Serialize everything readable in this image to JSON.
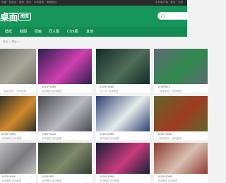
{
  "topbar": {
    "left_text": "收藏  · 壁纸站  · 搜索 · 图片 · 手机壁纸  · 桌面壁纸",
    "right_text": "手机客户端  · 登录  · 注册"
  },
  "logo": {
    "text": "桌面",
    "badge": "图库"
  },
  "search": {
    "placeholder": ""
  },
  "nav": {
    "items": [
      "壁纸",
      "截图",
      "原画",
      "同人图",
      "COS图",
      "其他"
    ]
  },
  "breadcrumb": "首页 > 壁纸 >",
  "cards": [
    {
      "thumb_color": "#6f6f6a",
      "accent": "#a9a79a",
      "resolution": "",
      "meta": "「某某游戏」 游戏截图"
    },
    {
      "thumb_color": "#2a1f4f",
      "accent": "#cf3fb0",
      "resolution": "1920*1080",
      "meta": "游戏截图 游戏截图"
    },
    {
      "thumb_color": "#132a2a",
      "accent": "#4f6e57",
      "resolution": "1920*1080",
      "meta": "Sunset 游戏截图"
    },
    {
      "thumb_color": "#5d6a75",
      "accent": "#2f8a4c",
      "resolution": "1440*810",
      "meta": "「某某游戏」游戏截图"
    },
    {
      "thumb_color": "#2c2f24",
      "accent": "#d28a2c",
      "resolution": "1920*1080",
      "meta": "游戏截图 游戏截图"
    },
    {
      "thumb_color": "#494a4f",
      "accent": "#b9b9c1",
      "resolution": "2560*1440",
      "meta": "游戏截图 游戏截图"
    },
    {
      "thumb_color": "#2c3f73",
      "accent": "#e4ece9",
      "resolution": "1920*1080",
      "meta": "游戏截图 游戏截图"
    },
    {
      "thumb_color": "#61642f",
      "accent": "#9e3c1f",
      "resolution": "1920*1080",
      "meta": "「某某游戏」游戏截图"
    },
    {
      "thumb_color": "#c2c2c4",
      "accent": "#7b7b7f",
      "resolution": "1920*1080",
      "meta": "游戏截图 游戏截图"
    },
    {
      "thumb_color": "#2e3b32",
      "accent": "#7f8a6a",
      "resolution": "2000*562",
      "meta": "游戏截图 游戏截图"
    },
    {
      "thumb_color": "#141f3a",
      "accent": "#c83a7a",
      "resolution": "1920*1080",
      "meta": "游戏截图 游戏截图"
    },
    {
      "thumb_color": "#8b3a2e",
      "accent": "#d9c0b2",
      "resolution": "1920*1080",
      "meta": "游戏截图 游戏截图"
    }
  ]
}
